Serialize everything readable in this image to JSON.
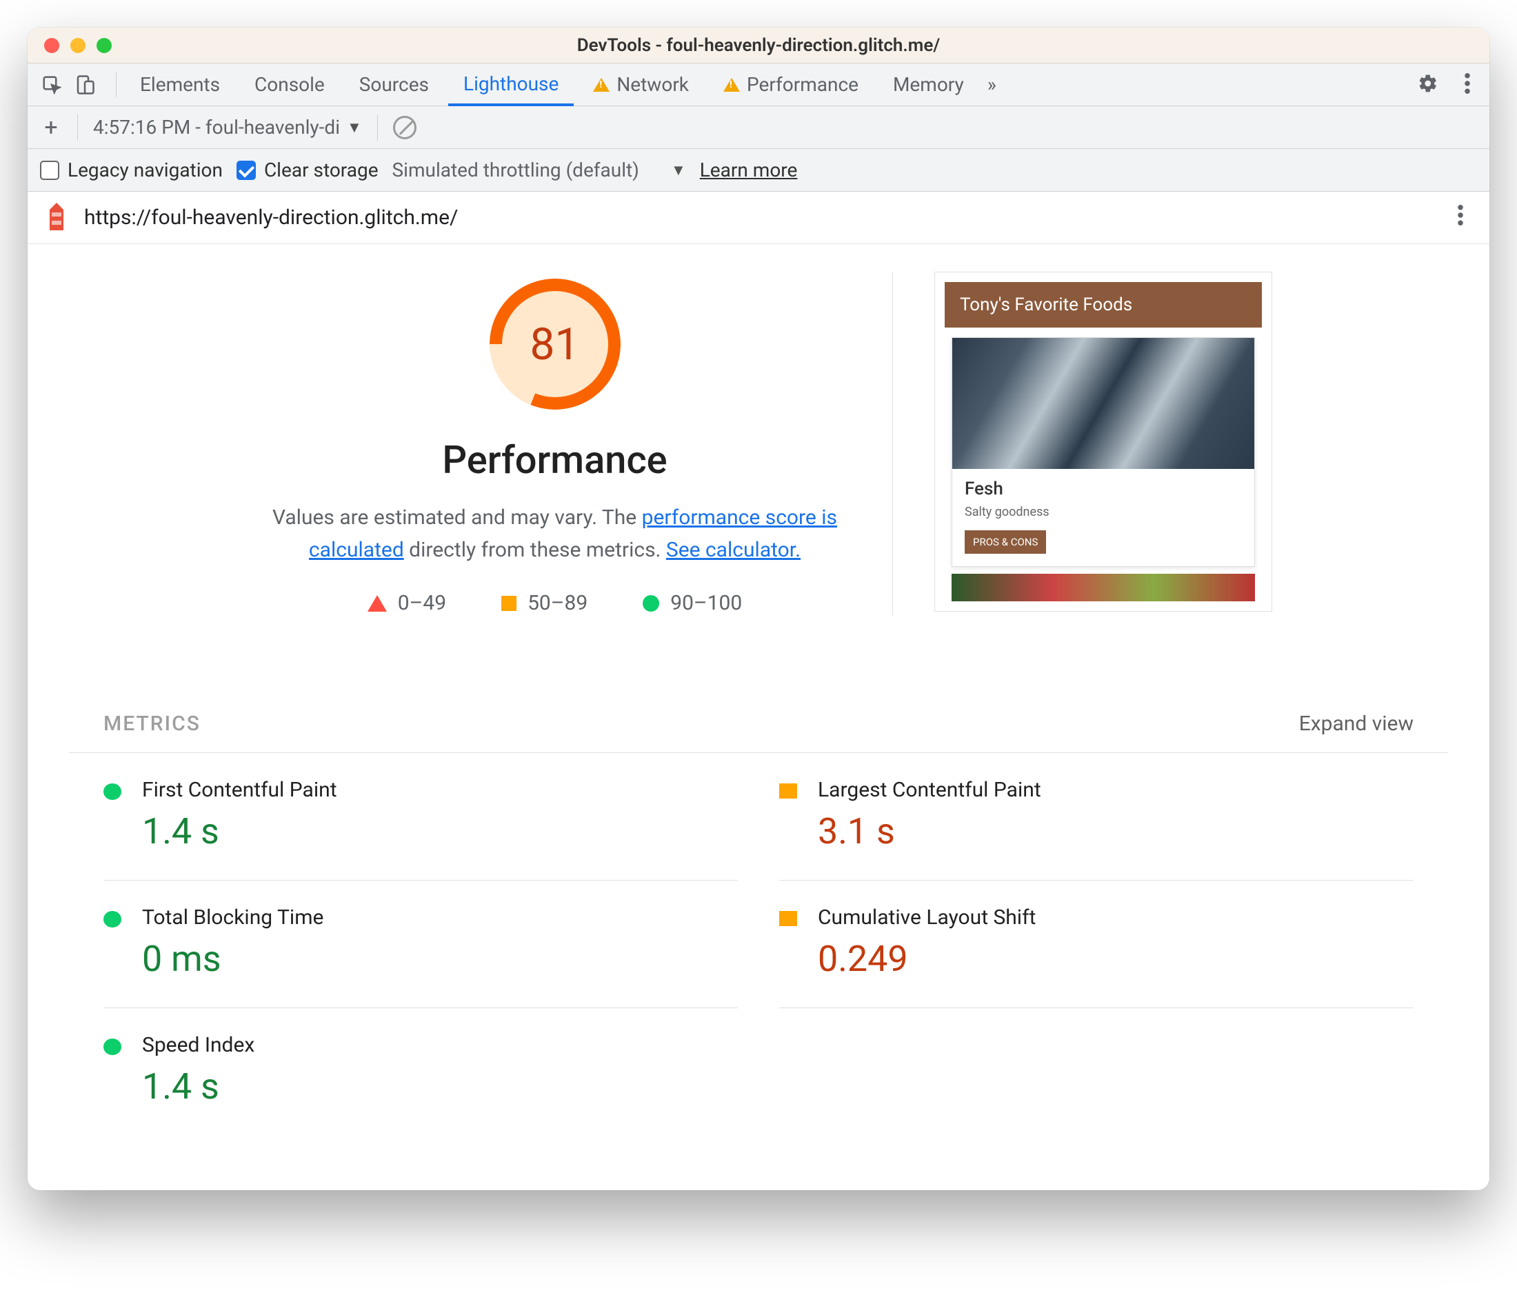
{
  "window": {
    "title": "DevTools - foul-heavenly-direction.glitch.me/"
  },
  "tabs": {
    "items": [
      {
        "label": "Elements",
        "warn": false
      },
      {
        "label": "Console",
        "warn": false
      },
      {
        "label": "Sources",
        "warn": false
      },
      {
        "label": "Lighthouse",
        "warn": false,
        "active": true
      },
      {
        "label": "Network",
        "warn": true
      },
      {
        "label": "Performance",
        "warn": true
      },
      {
        "label": "Memory",
        "warn": false
      }
    ]
  },
  "toolbar2": {
    "report_label": "4:57:16 PM - foul-heavenly-di"
  },
  "options": {
    "legacy_label": "Legacy navigation",
    "clear_label": "Clear storage",
    "throttle_label": "Simulated throttling (default)",
    "learn_more": "Learn more"
  },
  "url_row": {
    "url": "https://foul-heavenly-direction.glitch.me/"
  },
  "report": {
    "score": "81",
    "title": "Performance",
    "desc_prefix": "Values are estimated and may vary. The ",
    "desc_link1": "performance score is calculated",
    "desc_mid": " directly from these metrics. ",
    "desc_link2": "See calculator.",
    "legend": {
      "bad": "0–49",
      "mid": "50–89",
      "good": "90–100"
    }
  },
  "preview": {
    "header": "Tony's Favorite Foods",
    "card_title": "Fesh",
    "card_sub": "Salty goodness",
    "card_btn": "PROS & CONS"
  },
  "metrics": {
    "heading": "METRICS",
    "expand": "Expand view",
    "items": [
      {
        "label": "First Contentful Paint",
        "value": "1.4 s",
        "status": "green"
      },
      {
        "label": "Largest Contentful Paint",
        "value": "3.1 s",
        "status": "orange"
      },
      {
        "label": "Total Blocking Time",
        "value": "0 ms",
        "status": "green"
      },
      {
        "label": "Cumulative Layout Shift",
        "value": "0.249",
        "status": "orange"
      },
      {
        "label": "Speed Index",
        "value": "1.4 s",
        "status": "green"
      }
    ]
  }
}
